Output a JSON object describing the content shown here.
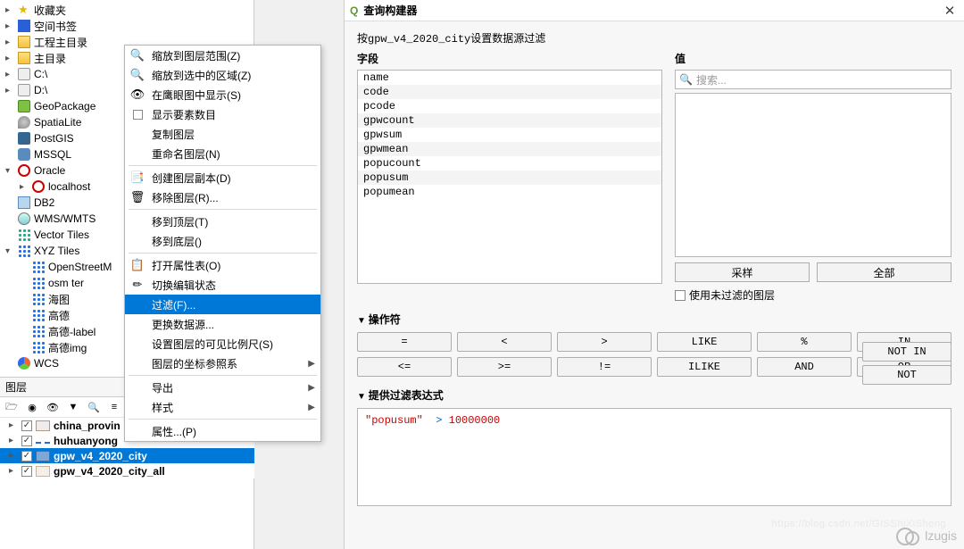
{
  "browser": {
    "items": [
      {
        "caret": "▸",
        "iconClass": "star",
        "iconText": "★",
        "label": "收藏夹",
        "nest": 0
      },
      {
        "caret": "▸",
        "iconClass": "bookmark-blue",
        "label": "空间书签",
        "nest": 0
      },
      {
        "caret": "▸",
        "iconClass": "folder-yellow",
        "label": "工程主目录",
        "nest": 0
      },
      {
        "caret": "▸",
        "iconClass": "folder-yellow",
        "label": "主目录",
        "nest": 0
      },
      {
        "caret": "▸",
        "iconClass": "disk",
        "label": "C:\\",
        "nest": 0
      },
      {
        "caret": "▸",
        "iconClass": "disk",
        "label": "D:\\",
        "nest": 0
      },
      {
        "caret": "",
        "iconClass": "gp",
        "label": "GeoPackage",
        "nest": 0
      },
      {
        "caret": "",
        "iconClass": "feather",
        "label": "SpatiaLite",
        "nest": 0
      },
      {
        "caret": "",
        "iconClass": "elephant",
        "label": "PostGIS",
        "nest": 0
      },
      {
        "caret": "",
        "iconClass": "dolphin",
        "label": "MSSQL",
        "nest": 0
      },
      {
        "caret": "▾",
        "iconClass": "redcircle",
        "label": "Oracle",
        "nest": 0
      },
      {
        "caret": "▸",
        "iconClass": "redcircle",
        "label": "localhost",
        "nest": 1
      },
      {
        "caret": "",
        "iconClass": "cube",
        "label": "DB2",
        "nest": 0
      },
      {
        "caret": "",
        "iconClass": "globe",
        "label": "WMS/WMTS",
        "nest": 0
      },
      {
        "caret": "",
        "iconClass": "dots-green",
        "label": "Vector Tiles",
        "nest": 0
      },
      {
        "caret": "▾",
        "iconClass": "dots-blue",
        "label": "XYZ Tiles",
        "nest": 0
      },
      {
        "caret": "",
        "iconClass": "dots-blue",
        "label": "OpenStreetM",
        "nest": 1
      },
      {
        "caret": "",
        "iconClass": "dots-blue",
        "label": "osm ter",
        "nest": 1
      },
      {
        "caret": "",
        "iconClass": "dots-blue",
        "label": "海图",
        "nest": 1
      },
      {
        "caret": "",
        "iconClass": "dots-blue",
        "label": "高德",
        "nest": 1
      },
      {
        "caret": "",
        "iconClass": "dots-blue",
        "label": "高德-label",
        "nest": 1
      },
      {
        "caret": "",
        "iconClass": "dots-blue",
        "label": "高德img",
        "nest": 1
      },
      {
        "caret": "",
        "iconClass": "wcs-icon",
        "label": "WCS",
        "nest": 0
      }
    ]
  },
  "ctx": {
    "items": [
      {
        "icon": "🔍",
        "label": "缩放到图层范围(Z)"
      },
      {
        "icon": "🔍",
        "label": "缩放到选中的区域(Z)"
      },
      {
        "icon": "👁",
        "label": "在鹰眼图中显示(S)"
      },
      {
        "icon": "☐",
        "label": "显示要素数目"
      },
      {
        "icon": "",
        "label": "复制图层"
      },
      {
        "icon": "",
        "label": "重命名图层(N)"
      },
      {
        "sep": true
      },
      {
        "icon": "📑",
        "label": "创建图层副本(D)"
      },
      {
        "icon": "🗑",
        "label": "移除图层(R)..."
      },
      {
        "sep": true
      },
      {
        "icon": "",
        "label": "移到顶层(T)"
      },
      {
        "icon": "",
        "label": "移到底层()"
      },
      {
        "sep": true
      },
      {
        "icon": "📋",
        "label": "打开属性表(O)"
      },
      {
        "icon": "✏",
        "label": "切换编辑状态"
      },
      {
        "icon": "",
        "label": "过滤(F)...",
        "hl": true
      },
      {
        "icon": "",
        "label": "更换数据源..."
      },
      {
        "icon": "",
        "label": "设置图层的可见比例尺(S)"
      },
      {
        "icon": "",
        "label": "图层的坐标参照系",
        "sub": true
      },
      {
        "sep": true
      },
      {
        "icon": "",
        "label": "导出",
        "sub": true
      },
      {
        "icon": "",
        "label": "样式",
        "sub": true
      },
      {
        "sep": true
      },
      {
        "icon": "",
        "label": "属性...(P)"
      }
    ]
  },
  "layers": {
    "title": "图层",
    "toolbar_icons": [
      "🗁",
      "◉",
      "👁",
      "▼",
      "🔍",
      "≡"
    ],
    "items": [
      {
        "chk": true,
        "shape": "poly-brown",
        "label": "china_provin"
      },
      {
        "chk": true,
        "shape": "line-blue",
        "label": "huhuanyong"
      },
      {
        "chk": true,
        "shape": "poly-blue",
        "label": "gpw_v4_2020_city",
        "sel": true
      },
      {
        "chk": true,
        "shape": "poly-pale",
        "label": "gpw_v4_2020_city_all"
      }
    ]
  },
  "qb": {
    "title": "查询构建器",
    "filter_prefix": "按",
    "filter_layer": "gpw_v4_2020_city",
    "filter_suffix": "设置数据源过滤",
    "fields_hdr": "字段",
    "fields": [
      "name",
      "code",
      "pcode",
      "gpwcount",
      "gpwsum",
      "gpwmean",
      "popucount",
      "popusum",
      "popumean"
    ],
    "values_hdr": "值",
    "search_glyph": "🔍",
    "search_placeholder": "搜索...",
    "btn_sample": "采样",
    "btn_all": "全部",
    "chk_unfiltered": "使用未过滤的图层",
    "ops_hdr": "操作符",
    "ops": [
      "=",
      "<",
      ">",
      "LIKE",
      "%",
      "IN",
      "<=",
      ">=",
      "!=",
      "ILIKE",
      "AND",
      "OR",
      "NOT IN",
      "NOT"
    ],
    "expr_hdr": "提供过滤表达式",
    "expr_field": "\"popusum\"",
    "expr_op": ">",
    "expr_val": "10000000"
  },
  "watermark": {
    "brand": "lzugis",
    "url": "https://blog.csdn.net/GISShiXiSheng"
  }
}
